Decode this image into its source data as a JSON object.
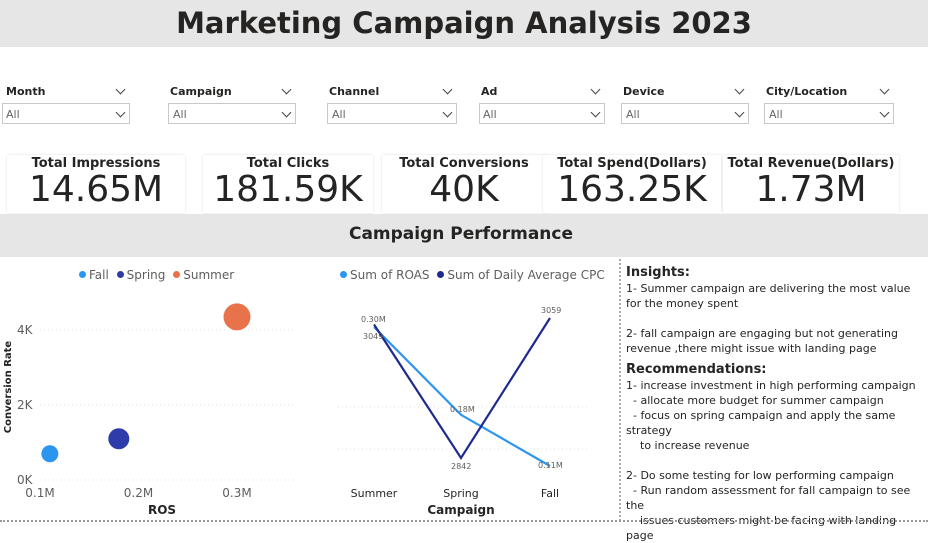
{
  "title": "Marketing Campaign Analysis 2023",
  "filters": [
    {
      "label": "Month",
      "value": "All"
    },
    {
      "label": "Campaign",
      "value": "All"
    },
    {
      "label": "Channel",
      "value": "All"
    },
    {
      "label": "Ad",
      "value": "All"
    },
    {
      "label": "Device",
      "value": "All"
    },
    {
      "label": "City/Location",
      "value": "All"
    }
  ],
  "kpis": [
    {
      "label": "Total Impressions",
      "value": "14.65M"
    },
    {
      "label": "Total Clicks",
      "value": "181.59K"
    },
    {
      "label": "Total Conversions",
      "value": "40K"
    },
    {
      "label": "Total Spend(Dollars)",
      "value": "163.25K"
    },
    {
      "label": "Total Revenue(Dollars)",
      "value": "1.73M"
    }
  ],
  "section_title": "Campaign Performance",
  "colors": {
    "fall": "#2b95f0",
    "spring": "#2e3ba8",
    "summer": "#e8734a",
    "roas": "#2b95f0",
    "cpc": "#1f2a8f"
  },
  "chart_data": [
    {
      "type": "scatter",
      "series": [
        {
          "name": "Fall",
          "x": 0.11,
          "y": 700
        },
        {
          "name": "Spring",
          "x": 0.18,
          "y": 1100
        },
        {
          "name": "Summer",
          "x": 0.3,
          "y": 4350
        }
      ],
      "legend": [
        "Fall",
        "Spring",
        "Summer"
      ],
      "xlabel": "ROS",
      "ylabel": "Conversion Rate",
      "xticks": [
        "0.1M",
        "0.2M",
        "0.3M"
      ],
      "yticks": [
        "0K",
        "2K",
        "4K"
      ],
      "xlim": [
        0.1,
        0.3
      ],
      "ylim": [
        0,
        5000
      ]
    },
    {
      "type": "line",
      "categories": [
        "Summer",
        "Spring",
        "Fall"
      ],
      "series": [
        {
          "name": "Sum of ROAS",
          "values": [
            0.3,
            0.18,
            0.11
          ],
          "labels": [
            "0.30M",
            "0.18M",
            "0.11M"
          ]
        },
        {
          "name": "Sum of Daily Average CPC",
          "values": [
            3049,
            2842,
            3059
          ],
          "labels": [
            "3049",
            "2842",
            "3059"
          ]
        }
      ],
      "xlabel": "Campaign",
      "legend": [
        "Sum of ROAS",
        "Sum of Daily Average CPC"
      ]
    }
  ],
  "insights": {
    "heading": "Insights:",
    "text": "1- Summer campaign are delivering the most value for the money spent\n\n2- fall campaign are engaging but not generating revenue ,there might issue with landing page",
    "rec_heading": "Recommendations:",
    "rec_text": "1- increase investment in high performing campaign\n  - allocate more budget for summer campaign\n  - focus on spring campaign and apply the same strategy\n    to increase revenue\n\n2- Do some testing for low performing campaign\n  - Run random assessment for fall campaign to see the\n    issues customers might be facing with landing page"
  }
}
